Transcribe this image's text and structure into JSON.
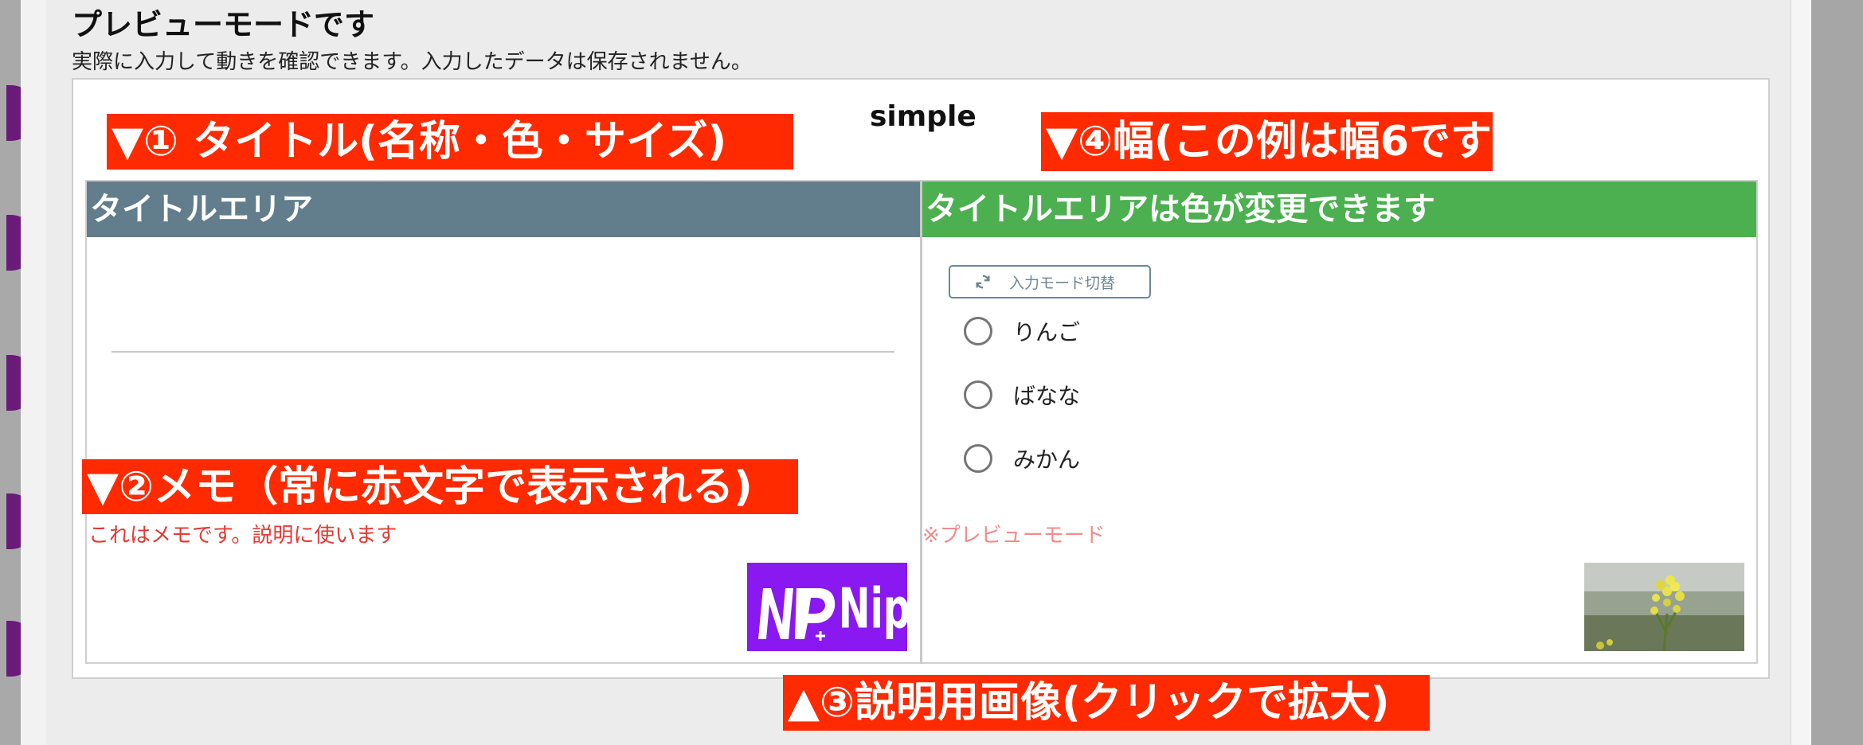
{
  "page": {
    "title": "プレビューモードです",
    "subtitle": "実際に入力して動きを確認できます。入力したデータは保存されません。"
  },
  "form": {
    "name": "simple",
    "left_cell": {
      "title": "タイトルエリア",
      "memo": "これはメモです。説明に使います",
      "logo_text": "NP+Nipo"
    },
    "right_cell": {
      "title": "タイトルエリアは色が変更できます",
      "switch_button": "入力モード切替",
      "options": [
        "りんご",
        "ばなな",
        "みかん"
      ],
      "preview_note": "※プレビューモード"
    }
  },
  "annotations": {
    "title_note": "▼① タイトル(名称・色・サイズ)",
    "memo_note": "▼②メモ（常に赤文字で表示される)",
    "image_note": "▲③説明用画像(クリックで拡大)",
    "width_note": "▼④幅(この例は幅6です)"
  },
  "colors": {
    "left_header": "#627d8b",
    "right_header": "#4caf50",
    "annotation_bg": "#ff2a00",
    "memo_text": "#e53935",
    "logo_bg": "#8a18f0"
  },
  "icons": [
    "refresh-icon"
  ]
}
